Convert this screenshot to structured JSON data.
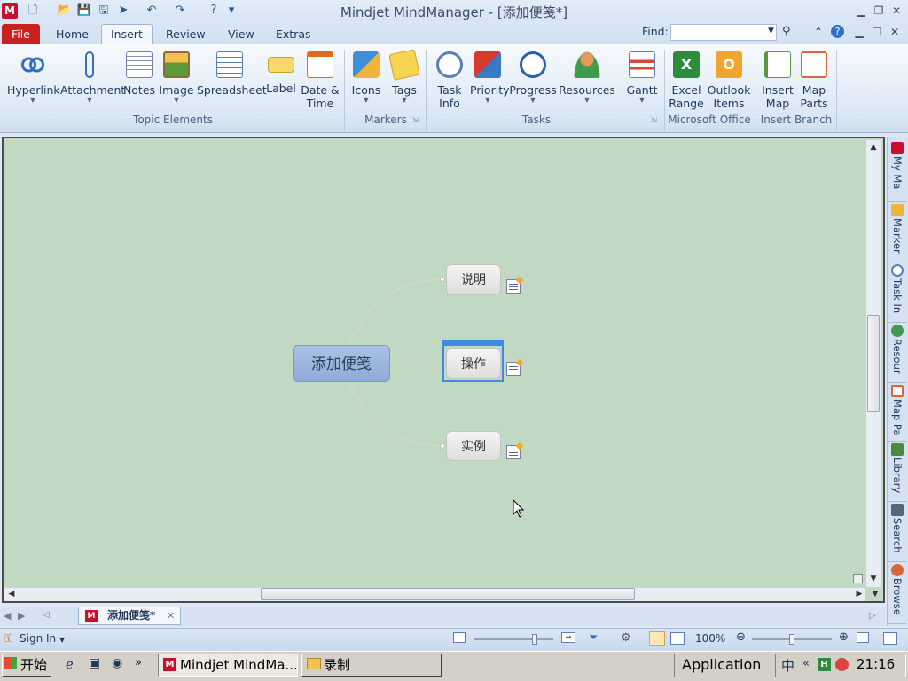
{
  "window": {
    "title": "Mindjet MindManager - [添加便笺*]",
    "logo_letter": "M"
  },
  "tabs": [
    {
      "label": "File"
    },
    {
      "label": "Home"
    },
    {
      "label": "Insert"
    },
    {
      "label": "Review"
    },
    {
      "label": "View"
    },
    {
      "label": "Extras"
    }
  ],
  "active_tab": "Insert",
  "find": {
    "label": "Find:",
    "value": ""
  },
  "ribbon": {
    "groups": [
      {
        "label": "Topic Elements"
      },
      {
        "label": "Markers"
      },
      {
        "label": "Tasks"
      },
      {
        "label": "Microsoft Office"
      },
      {
        "label": "Insert Branch"
      }
    ],
    "buttons": [
      {
        "line1": "Hyperlink",
        "line2": ""
      },
      {
        "line1": "Attachment",
        "line2": ""
      },
      {
        "line1": "Notes",
        "line2": ""
      },
      {
        "line1": "Image",
        "line2": ""
      },
      {
        "line1": "Spreadsheet",
        "line2": ""
      },
      {
        "line1": "Label",
        "line2": ""
      },
      {
        "line1": "Date &",
        "line2": "Time"
      },
      {
        "line1": "Icons",
        "line2": ""
      },
      {
        "line1": "Tags",
        "line2": ""
      },
      {
        "line1": "Task",
        "line2": "Info"
      },
      {
        "line1": "Priority",
        "line2": ""
      },
      {
        "line1": "Progress",
        "line2": ""
      },
      {
        "line1": "Resources",
        "line2": ""
      },
      {
        "line1": "Gantt",
        "line2": ""
      },
      {
        "line1": "Excel",
        "line2": "Range"
      },
      {
        "line1": "Outlook",
        "line2": "Items"
      },
      {
        "line1": "Insert",
        "line2": "Map"
      },
      {
        "line1": "Map",
        "line2": "Parts"
      }
    ]
  },
  "map": {
    "central_topic": "添加便笺",
    "subtopics": [
      {
        "label": "说明"
      },
      {
        "label": "操作"
      },
      {
        "label": "实例"
      }
    ]
  },
  "side_pane": {
    "tabs": [
      {
        "label": "My Ma"
      },
      {
        "label": "Marker"
      },
      {
        "label": "Task In"
      },
      {
        "label": "Resour"
      },
      {
        "label": "Map Pa"
      },
      {
        "label": "Library"
      },
      {
        "label": "Search"
      },
      {
        "label": "Browse"
      }
    ]
  },
  "document_tab": {
    "label": "添加便笺*"
  },
  "status": {
    "sign_in": "Sign In",
    "zoom": "100%"
  },
  "taskbar": {
    "start": "开始",
    "tasks": [
      {
        "label": "Mindjet MindMa..."
      },
      {
        "label": "录制"
      }
    ],
    "toolbar_label": "Application",
    "clock": "21:16"
  },
  "colors": {
    "canvas_bg": "#c1d9c3",
    "central_topic": "#9bb5de",
    "selection": "#3e8ce0",
    "file_tab": "#c9211e"
  }
}
